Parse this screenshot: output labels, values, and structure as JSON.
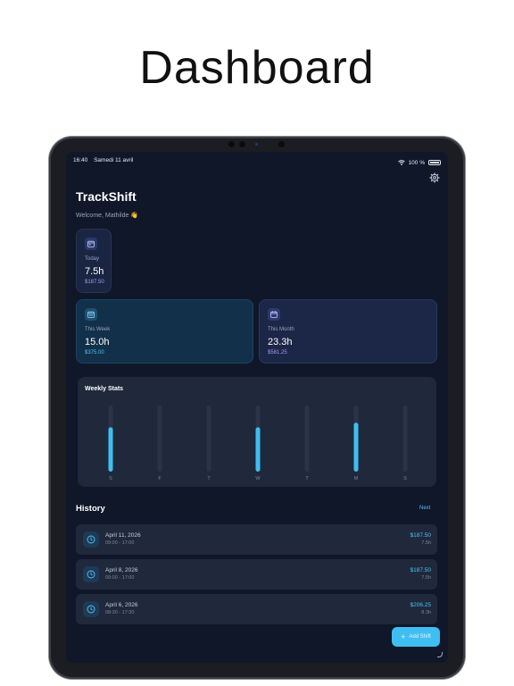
{
  "page": {
    "title": "Dashboard"
  },
  "status_bar": {
    "time": "16:40",
    "date": "Samedi 11 avril",
    "battery": "100 %"
  },
  "header": {
    "app_title": "TrackShift",
    "welcome": "Welcome, Mathilde 👋"
  },
  "summary_cards": [
    {
      "label": "Today",
      "hours": "7.5h",
      "amount": "$187.50",
      "icon": "calendar-icon"
    },
    {
      "label": "This Week",
      "hours": "15.0h",
      "amount": "$375.00",
      "icon": "calendar-week-icon"
    },
    {
      "label": "This Month",
      "hours": "23.3h",
      "amount": "$581.25",
      "icon": "calendar-month-icon"
    }
  ],
  "weekly_stats": {
    "title": "Weekly Stats",
    "accent": "#3fbef2",
    "track_color": "#2a3447",
    "chart_data": {
      "type": "bar",
      "categories": [
        "S",
        "F",
        "T",
        "W",
        "T",
        "M",
        "S"
      ],
      "values": [
        0.67,
        0,
        0,
        0.67,
        0,
        0.74,
        0
      ],
      "ylim": [
        0,
        1
      ]
    }
  },
  "history": {
    "title": "History",
    "next_label": "Next",
    "items": [
      {
        "date": "April 11, 2026",
        "time": "09:00 - 17:00",
        "amount": "$187.50",
        "hours": "7.5h"
      },
      {
        "date": "April 8, 2026",
        "time": "09:00 - 17:00",
        "amount": "$187.50",
        "hours": "7.5h"
      },
      {
        "date": "April 6, 2026",
        "time": "08:30 - 17:30",
        "amount": "$206.25",
        "hours": "8.3h"
      }
    ]
  },
  "fab": {
    "label": "Add Shift"
  }
}
